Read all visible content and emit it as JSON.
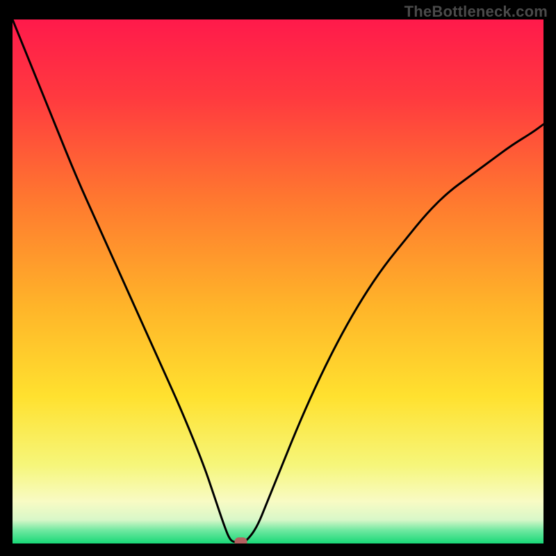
{
  "watermark": "TheBottleneck.com",
  "chart_data": {
    "type": "line",
    "title": "",
    "xlabel": "",
    "ylabel": "",
    "xlim": [
      0,
      100
    ],
    "ylim": [
      0,
      100
    ],
    "grid": false,
    "x": [
      0,
      4,
      8,
      12,
      16,
      20,
      24,
      28,
      32,
      36,
      38,
      40,
      41,
      42,
      43,
      44,
      46,
      48,
      50,
      54,
      58,
      62,
      66,
      70,
      74,
      78,
      82,
      86,
      90,
      94,
      98,
      100
    ],
    "y": [
      100,
      90,
      80,
      70,
      61,
      52,
      43,
      34,
      25,
      15,
      9,
      3,
      0.6,
      0.2,
      0.2,
      0.4,
      3,
      8,
      13,
      23,
      32,
      40,
      47,
      53,
      58,
      63,
      67,
      70,
      73,
      76,
      78.5,
      80
    ],
    "marker": {
      "x": 43,
      "y": 0.3
    },
    "gradient_stops": [
      {
        "offset": 0.0,
        "color": "#ff1a4b"
      },
      {
        "offset": 0.15,
        "color": "#ff3a3f"
      },
      {
        "offset": 0.35,
        "color": "#ff7a2f"
      },
      {
        "offset": 0.55,
        "color": "#ffb529"
      },
      {
        "offset": 0.72,
        "color": "#ffe12f"
      },
      {
        "offset": 0.85,
        "color": "#f6f67a"
      },
      {
        "offset": 0.92,
        "color": "#f8fbc4"
      },
      {
        "offset": 0.955,
        "color": "#d8f7c8"
      },
      {
        "offset": 0.975,
        "color": "#6fe8a0"
      },
      {
        "offset": 1.0,
        "color": "#18d877"
      }
    ],
    "curve_color": "#000000",
    "marker_color": "#b46060"
  }
}
